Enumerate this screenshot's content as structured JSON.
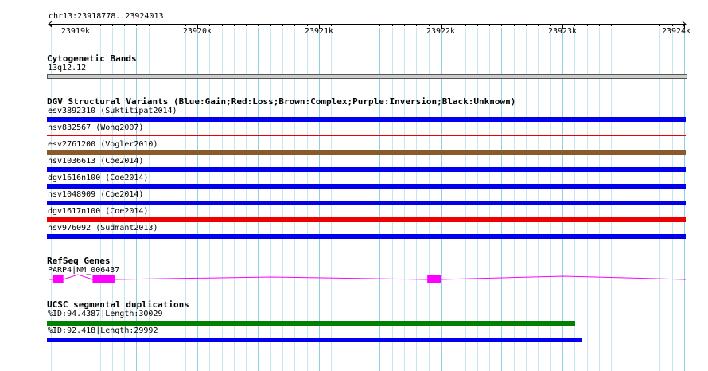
{
  "region": "chr13:23918778..23924013",
  "ruler": {
    "start": 23918778,
    "end": 23924013,
    "ticks": [
      {
        "pos": 23919000,
        "label": "23919k"
      },
      {
        "pos": 23920000,
        "label": "23920k"
      },
      {
        "pos": 23921000,
        "label": "23921k"
      },
      {
        "pos": 23922000,
        "label": "23922k"
      },
      {
        "pos": 23923000,
        "label": "23923k"
      },
      {
        "pos": 23924000,
        "label": "23924k"
      }
    ]
  },
  "tracks": {
    "cytobands": {
      "title": "Cytogenetic Bands",
      "band_label": "13q12.12",
      "band_color": "#cccccc",
      "band_start": 23918778,
      "band_end": 23924013
    },
    "dgv": {
      "title": "DGV Structural Variants (Blue:Gain;Red:Loss;Brown:Complex;Purple:Inversion;Black:Unknown)",
      "variants": [
        {
          "label": "esv3892310 (Suktitipat2014)",
          "color": "#0000ee",
          "start": 23918778,
          "end": 23924013
        },
        {
          "label": "nsv832567 (Wong2007)",
          "color": "#ee0000",
          "start": 23918778,
          "end": 23924013
        },
        {
          "label": "esv2761200 (Vogler2010)",
          "color": "#8b5a2b",
          "start": 23918778,
          "end": 23924013
        },
        {
          "label": "nsv1036613 (Coe2014)",
          "color": "#0000ee",
          "start": 23918778,
          "end": 23924013
        },
        {
          "label": "dgv1616n100 (Coe2014)",
          "color": "#0000ee",
          "start": 23918778,
          "end": 23924013
        },
        {
          "label": "nsv1048909 (Coe2014)",
          "color": "#0000ee",
          "start": 23918778,
          "end": 23924013
        },
        {
          "label": "dgv1617n100 (Coe2014)",
          "color": "#ee0000",
          "start": 23918778,
          "end": 23924013
        },
        {
          "label": "nsv976092 (Sudmant2013)",
          "color": "#0000ee",
          "start": 23918778,
          "end": 23924013
        }
      ]
    },
    "refseq": {
      "title": "RefSeq Genes",
      "gene_label": "PARP4|NM_006437",
      "color": "#ff00ff",
      "start": 23918778,
      "end": 23924013,
      "exons": [
        {
          "start": 23918810,
          "end": 23918900
        },
        {
          "start": 23919140,
          "end": 23919320
        },
        {
          "start": 23921890,
          "end": 23922000
        }
      ]
    },
    "segdups": {
      "title": "UCSC segmental duplications",
      "items": [
        {
          "label": "%ID:94.4387|Length:30029",
          "color": "#008000",
          "start": 23918778,
          "end": 23923105
        },
        {
          "label": "%ID:92.418|Length:29992",
          "color": "#0000ee",
          "start": 23918778,
          "end": 23923155
        }
      ]
    }
  }
}
